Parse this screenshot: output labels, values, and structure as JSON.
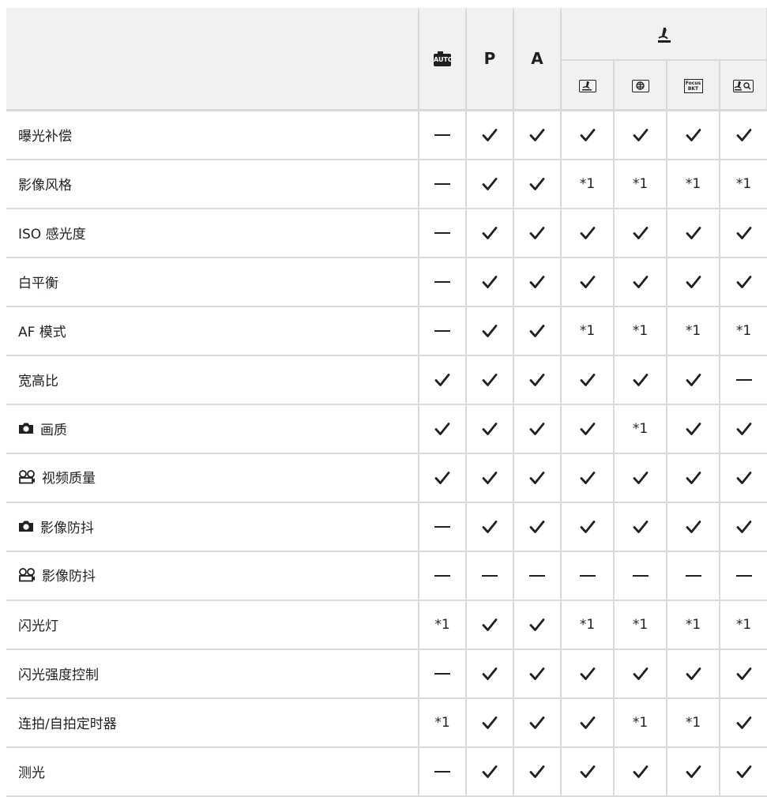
{
  "header": {
    "modes": [
      "auto",
      "P",
      "A"
    ],
    "group_icon": "microscope-icon",
    "sub_modes": [
      "microscope-mode-icon",
      "focus-stacking-icon",
      "focus-bracketing-icon",
      "microscope-control-icon"
    ],
    "sub_labels": [
      "",
      "",
      "Focus BKT",
      ""
    ]
  },
  "rows": [
    {
      "label": "曝光补偿",
      "icon": "",
      "values": [
        "—",
        "✓",
        "✓",
        "✓",
        "✓",
        "✓",
        "✓"
      ]
    },
    {
      "label": "影像风格",
      "icon": "",
      "values": [
        "—",
        "✓",
        "✓",
        "*1",
        "*1",
        "*1",
        "*1"
      ]
    },
    {
      "label": "ISO 感光度",
      "icon": "",
      "values": [
        "—",
        "✓",
        "✓",
        "✓",
        "✓",
        "✓",
        "✓"
      ]
    },
    {
      "label": "白平衡",
      "icon": "",
      "values": [
        "—",
        "✓",
        "✓",
        "✓",
        "✓",
        "✓",
        "✓"
      ]
    },
    {
      "label": "AF 模式",
      "icon": "",
      "values": [
        "—",
        "✓",
        "✓",
        "*1",
        "*1",
        "*1",
        "*1"
      ]
    },
    {
      "label": "宽高比",
      "icon": "",
      "values": [
        "✓",
        "✓",
        "✓",
        "✓",
        "✓",
        "✓",
        "—"
      ]
    },
    {
      "label": "画质",
      "icon": "camera-icon",
      "values": [
        "✓",
        "✓",
        "✓",
        "✓",
        "*1",
        "✓",
        "✓"
      ]
    },
    {
      "label": "视频质量",
      "icon": "video-icon",
      "values": [
        "✓",
        "✓",
        "✓",
        "✓",
        "✓",
        "✓",
        "✓"
      ]
    },
    {
      "label": "影像防抖",
      "icon": "camera-icon",
      "values": [
        "—",
        "✓",
        "✓",
        "✓",
        "✓",
        "✓",
        "✓"
      ]
    },
    {
      "label": "影像防抖",
      "icon": "video-icon",
      "values": [
        "—",
        "—",
        "—",
        "—",
        "—",
        "—",
        "—"
      ]
    },
    {
      "label": "闪光灯",
      "icon": "",
      "values": [
        "*1",
        "✓",
        "✓",
        "*1",
        "*1",
        "*1",
        "*1"
      ]
    },
    {
      "label": "闪光强度控制",
      "icon": "",
      "values": [
        "—",
        "✓",
        "✓",
        "✓",
        "✓",
        "✓",
        "✓"
      ]
    },
    {
      "label": "连拍/自拍定时器",
      "icon": "",
      "values": [
        "*1",
        "✓",
        "✓",
        "✓",
        "*1",
        "*1",
        "✓"
      ]
    },
    {
      "label": "测光",
      "icon": "",
      "values": [
        "—",
        "✓",
        "✓",
        "✓",
        "✓",
        "✓",
        "✓"
      ]
    }
  ]
}
